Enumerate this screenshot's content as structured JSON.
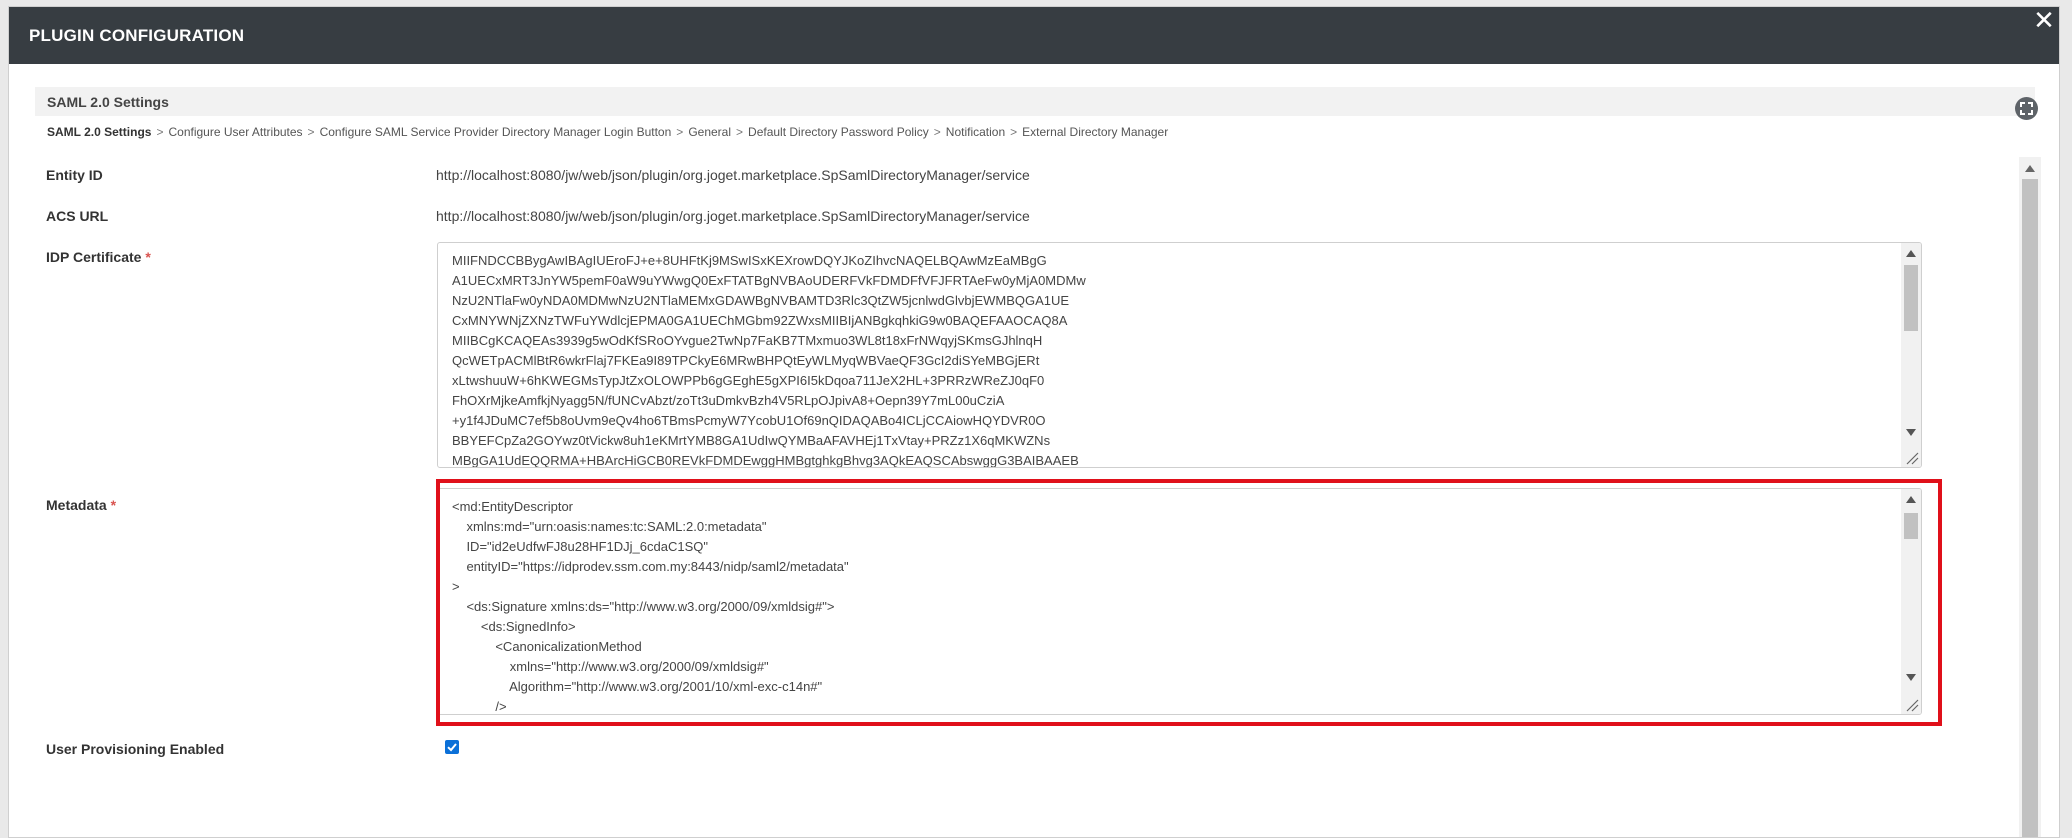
{
  "dialog": {
    "title": "PLUGIN CONFIGURATION",
    "close_glyph": "✕"
  },
  "section": {
    "title": "SAML 2.0 Settings",
    "expand_icon": "fullscreen-icon"
  },
  "breadcrumb": [
    {
      "label": "SAML 2.0 Settings",
      "active": true
    },
    {
      "label": "Configure User Attributes",
      "active": false
    },
    {
      "label": "Configure SAML Service Provider Directory Manager Login Button",
      "active": false
    },
    {
      "label": "General",
      "active": false
    },
    {
      "label": "Default Directory Password Policy",
      "active": false
    },
    {
      "label": "Notification",
      "active": false
    },
    {
      "label": "External Directory Manager",
      "active": false
    }
  ],
  "breadcrumb_separator": ">",
  "fields": {
    "entity_id": {
      "label": "Entity ID",
      "value": "http://localhost:8080/jw/web/json/plugin/org.joget.marketplace.SpSamlDirectoryManager/service"
    },
    "acs_url": {
      "label": "ACS URL",
      "value": "http://localhost:8080/jw/web/json/plugin/org.joget.marketplace.SpSamlDirectoryManager/service"
    },
    "idp_certificate": {
      "label": "IDP Certificate",
      "required_mark": "*",
      "lines": [
        "MIIFNDCCBBygAwIBAgIUEroFJ+e+8UHFtKj9MSwISxKEXrowDQYJKoZIhvcNAQELBQAwMzEaMBgG",
        "A1UECxMRT3JnYW5pemF0aW9uYWwgQ0ExFTATBgNVBAoUDERFVkFDMDFfVFJFRTAeFw0yMjA0MDMw",
        "NzU2NTlaFw0yNDA0MDMwNzU2NTlaMEMxGDAWBgNVBAMTD3Rlc3QtZW5jcnlwdGlvbjEWMBQGA1UE",
        "CxMNYWNjZXNzTWFuYWdlcjEPMA0GA1UEChMGbm92ZWxsMIIBIjANBgkqhkiG9w0BAQEFAAOCAQ8A",
        "MIIBCgKCAQEAs3939g5wOdKfSRoOYvgue2TwNp7FaKB7TMxmuo3WL8t18xFrNWqyjSKmsGJhlnqH",
        "QcWETpACMlBtR6wkrFlaj7FKEa9I89TPCkyE6MRwBHPQtEyWLMyqWBVaeQF3GcI2diSYeMBGjERt",
        "xLtwshuuW+6hKWEGMsTypJtZxOLOWPPb6gGEghE5gXPI6I5kDqoa711JeX2HL+3PRRzWReZJ0qF0",
        "FhOXrMjkeAmfkjNyagg5N/fUNCvAbzt/zoTt3uDmkvBzh4V5RLpOJpivA8+Oepn39Y7mL00uCziA",
        "+y1f4JDuMC7ef5b8oUvm9eQv4ho6TBmsPcmyW7YcobU1Of69nQIDAQABo4ICLjCCAiowHQYDVR0O",
        "BBYEFCpZa2GOYwz0tVickw8uh1eKMrtYMB8GA1UdIwQYMBaAFAVHEj1TxVtay+PRZz1X6qMKWZNs",
        "MBgGA1UdEQQRMA+HBArcHiGCB0REVkFDMDEwggHMBgtghkgBhvg3AQkEAQSCAbswggG3BAIBAAEB"
      ]
    },
    "metadata": {
      "label": "Metadata",
      "required_mark": "*",
      "lines": [
        "<md:EntityDescriptor",
        "    xmlns:md=\"urn:oasis:names:tc:SAML:2.0:metadata\"",
        "    ID=\"id2eUdfwFJ8u28HF1DJj_6cdaC1SQ\"",
        "    entityID=\"https://idprodev.ssm.com.my:8443/nidp/saml2/metadata\"",
        ">",
        "    <ds:Signature xmlns:ds=\"http://www.w3.org/2000/09/xmldsig#\">",
        "        <ds:SignedInfo>",
        "            <CanonicalizationMethod",
        "                xmlns=\"http://www.w3.org/2000/09/xmldsig#\"",
        "                Algorithm=\"http://www.w3.org/2001/10/xml-exc-c14n#\"",
        "            />"
      ]
    },
    "user_provisioning": {
      "label": "User Provisioning Enabled",
      "checked": true
    }
  },
  "colors": {
    "titlebar": "#373d42",
    "highlight": "#e0101a",
    "required": "#d9534f",
    "checkbox": "#0b70d8"
  }
}
